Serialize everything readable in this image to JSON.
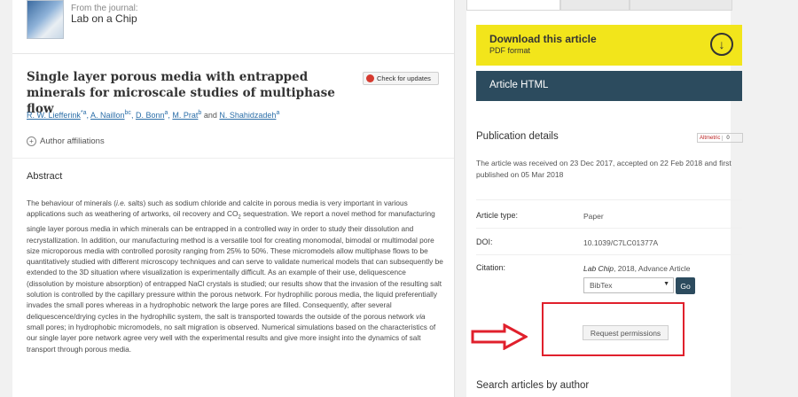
{
  "journal": {
    "from_label": "From the journal:",
    "name": "Lab on a Chip"
  },
  "updates_label": "Check for updates",
  "title": "Single layer porous media with entrapped minerals for microscale studies of multiphase flow",
  "authors": [
    {
      "name": "R. W. Liefferink",
      "sup": "*a"
    },
    {
      "name": "A. Naillon",
      "sup": "bc"
    },
    {
      "name": "D. Bonn",
      "sup": "a"
    },
    {
      "name": "M. Prat",
      "sup": "b"
    },
    {
      "name": "N. Shahidzadeh",
      "sup": "a"
    }
  ],
  "authors_and": "and",
  "affiliations_label": "Author affiliations",
  "abstract_heading": "Abstract",
  "abstract_parts": {
    "p1": "The behaviour of minerals (",
    "p1i": "i.e.",
    "p2": " salts) such as sodium chloride and calcite in porous media is very important in various applications such as weathering of artworks, oil recovery and CO",
    "p2sub": "2",
    "p3": " sequestration. We report a novel method for manufacturing single layer porous media in which minerals can be entrapped in a controlled way in order to study their dissolution and recrystallization. In addition, our manufacturing method is a versatile tool for creating monomodal, bimodal or multimodal pore size microporous media with controlled porosity ranging from 25% to 50%. These micromodels allow multiphase flows to be quantitatively studied with different microscopy techniques and can serve to validate numerical models that can subsequently be extended to the 3D situation where visualization is experimentally difficult. As an example of their use, deliquescence (dissolution by moisture absorption) of entrapped NaCl crystals is studied; our results show that the invasion of the resulting salt solution is controlled by the capillary pressure within the porous network. For hydrophilic porous media, the liquid preferentially invades the small pores whereas in a hydrophobic network the large pores are filled. Consequently, after several deliquescence/drying cycles in the hydrophilic system, the salt is transported towards the outside of the porous network ",
    "p3i": "via",
    "p4": " small pores; in hydrophobic micromodels, no salt migration is observed. Numerical simulations based on the characteristics of our single layer pore network agree very well with the experimental results and give more insight into the dynamics of salt transport through porous media."
  },
  "download": {
    "title": "Download this article",
    "subtitle": "PDF format",
    "icon": "download-icon"
  },
  "html_button": "Article HTML",
  "publication": {
    "heading": "Publication details",
    "altmetric_label": "Altmetric",
    "altmetric_count": "0",
    "history": "The article was received on 23 Dec 2017, accepted on 22 Feb 2018 and first published on 05 Mar 2018"
  },
  "details": {
    "type_label": "Article type:",
    "type_value": "Paper",
    "doi_label": "DOI:",
    "doi_value": "10.1039/C7LC01377A",
    "citation_label": "Citation:",
    "citation_journal": "Lab Chip",
    "citation_rest": ", 2018, Advance Article"
  },
  "bibtex": {
    "selected": "BibTex",
    "go_label": "Go"
  },
  "permissions_label": "Request permissions",
  "search_heading": "Search articles by author",
  "colors": {
    "download_bg": "#f2e51b",
    "html_bg": "#2c4b5e",
    "highlight": "#e0202c",
    "link": "#2b6ea8"
  }
}
